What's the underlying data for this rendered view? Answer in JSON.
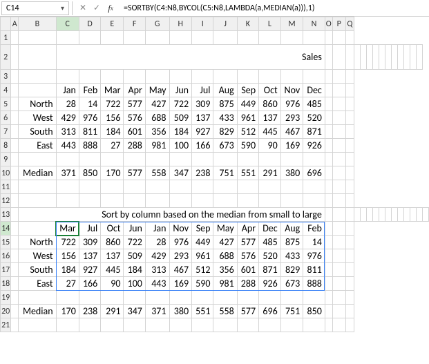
{
  "active_cell_ref": "C14",
  "formula": "=SORTBY(C4:N8,BYCOL(C5:N8,LAMBDA(a,MEDIAN(a))),1)",
  "col_headers": [
    "A",
    "B",
    "C",
    "D",
    "E",
    "F",
    "G",
    "H",
    "I",
    "J",
    "K",
    "L",
    "M",
    "N",
    "O",
    "P",
    "Q"
  ],
  "row_headers": [
    "1",
    "2",
    "3",
    "4",
    "5",
    "6",
    "7",
    "8",
    "9",
    "10",
    "11",
    "12",
    "13",
    "14",
    "15",
    "16",
    "17",
    "18",
    "19",
    "20",
    "21"
  ],
  "title": "Sales",
  "months": [
    "Jan",
    "Feb",
    "Mar",
    "Apr",
    "May",
    "Jun",
    "Jul",
    "Aug",
    "Sep",
    "Oct",
    "Nov",
    "Dec"
  ],
  "regions": [
    "North",
    "West",
    "South",
    "East"
  ],
  "sales_values": [
    [
      28,
      14,
      722,
      577,
      427,
      722,
      309,
      875,
      449,
      860,
      976,
      485
    ],
    [
      429,
      976,
      156,
      576,
      688,
      509,
      137,
      433,
      961,
      137,
      293,
      520
    ],
    [
      313,
      811,
      184,
      601,
      356,
      184,
      927,
      829,
      512,
      445,
      467,
      871
    ],
    [
      443,
      888,
      27,
      288,
      981,
      100,
      166,
      673,
      590,
      90,
      169,
      926
    ]
  ],
  "median_label": "Median",
  "median_values": [
    371,
    850,
    170,
    577,
    558,
    347,
    238,
    751,
    551,
    291,
    380,
    696
  ],
  "banner_text": "Sort by column based on the median from small to large",
  "sorted_months": [
    "Mar",
    "Jul",
    "Oct",
    "Jun",
    "Jan",
    "Nov",
    "Sep",
    "May",
    "Apr",
    "Dec",
    "Aug",
    "Feb"
  ],
  "sorted_values": [
    [
      722,
      309,
      860,
      722,
      28,
      976,
      449,
      427,
      577,
      485,
      875,
      14
    ],
    [
      156,
      137,
      137,
      509,
      429,
      293,
      961,
      688,
      576,
      520,
      433,
      976
    ],
    [
      184,
      927,
      445,
      184,
      313,
      467,
      512,
      356,
      601,
      871,
      829,
      811
    ],
    [
      27,
      166,
      90,
      100,
      443,
      169,
      590,
      981,
      288,
      926,
      673,
      888
    ]
  ],
  "sorted_median_values": [
    170,
    238,
    291,
    347,
    371,
    380,
    551,
    558,
    577,
    696,
    751,
    850
  ],
  "chart_data": {
    "type": "table",
    "title": "Sales",
    "categories": [
      "Jan",
      "Feb",
      "Mar",
      "Apr",
      "May",
      "Jun",
      "Jul",
      "Aug",
      "Sep",
      "Oct",
      "Nov",
      "Dec"
    ],
    "series": [
      {
        "name": "North",
        "values": [
          28,
          14,
          722,
          577,
          427,
          722,
          309,
          875,
          449,
          860,
          976,
          485
        ]
      },
      {
        "name": "West",
        "values": [
          429,
          976,
          156,
          576,
          688,
          509,
          137,
          433,
          961,
          137,
          293,
          520
        ]
      },
      {
        "name": "South",
        "values": [
          313,
          811,
          184,
          601,
          356,
          184,
          927,
          829,
          512,
          445,
          467,
          871
        ]
      },
      {
        "name": "East",
        "values": [
          443,
          888,
          27,
          288,
          981,
          100,
          166,
          673,
          590,
          90,
          169,
          926
        ]
      },
      {
        "name": "Median",
        "values": [
          371,
          850,
          170,
          577,
          558,
          347,
          238,
          751,
          551,
          291,
          380,
          696
        ]
      }
    ]
  }
}
